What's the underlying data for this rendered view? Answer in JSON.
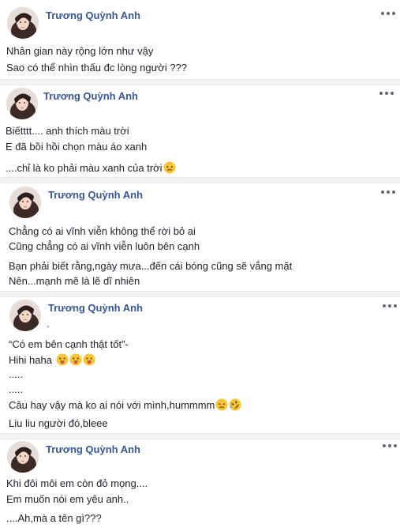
{
  "author": {
    "name": "Trương Quỳnh Anh"
  },
  "icons": {
    "avatar": "profile-photo",
    "more": "more-options-icon",
    "emoji_worried": "worried-face-icon",
    "emoji_tongue": "winking-tongue-face-icon",
    "emoji_sad": "disappointed-face-icon",
    "emoji_laugh": "rolling-laughing-face-icon"
  },
  "posts": [
    {
      "lines": [
        "Nhân gian này rộng lớn như vậy",
        "Sao có thể nhìn thấu đc lòng người ???"
      ]
    },
    {
      "lines": [
        "Biếtttt.... anh thích màu trời",
        "E đã bồi hồi chọn màu áo xanh",
        "....chỉ là ko phải màu xanh của trời"
      ]
    },
    {
      "lines": [
        "Chẳng có ai vĩnh viễn không thể rời bỏ ai",
        "Cũng chẳng có ai vĩnh viễn luôn bên cạnh",
        "Bạn phải biết rằng,ngày mưa...đến cái bóng cũng sẽ vắng mặt",
        "Nên...mạnh mẽ là lẽ dĩ nhiên"
      ]
    },
    {
      "lines": [
        ".",
        "“Có em bên cạnh thật tốt”-",
        "Hihi haha",
        ".....",
        ".....",
        "Câu hay vậy mà ko ai nói với mình,hummmm",
        "Liu liu người đó,bleee"
      ]
    },
    {
      "lines": [
        "Khi đôi môi em còn đỏ mọng....",
        "Em muốn nói em yêu anh..",
        "....Ah,mà a tên gì???"
      ]
    }
  ],
  "colors": {
    "name": "#385898",
    "text": "#1d2129",
    "divider": "#f2f3f5"
  }
}
